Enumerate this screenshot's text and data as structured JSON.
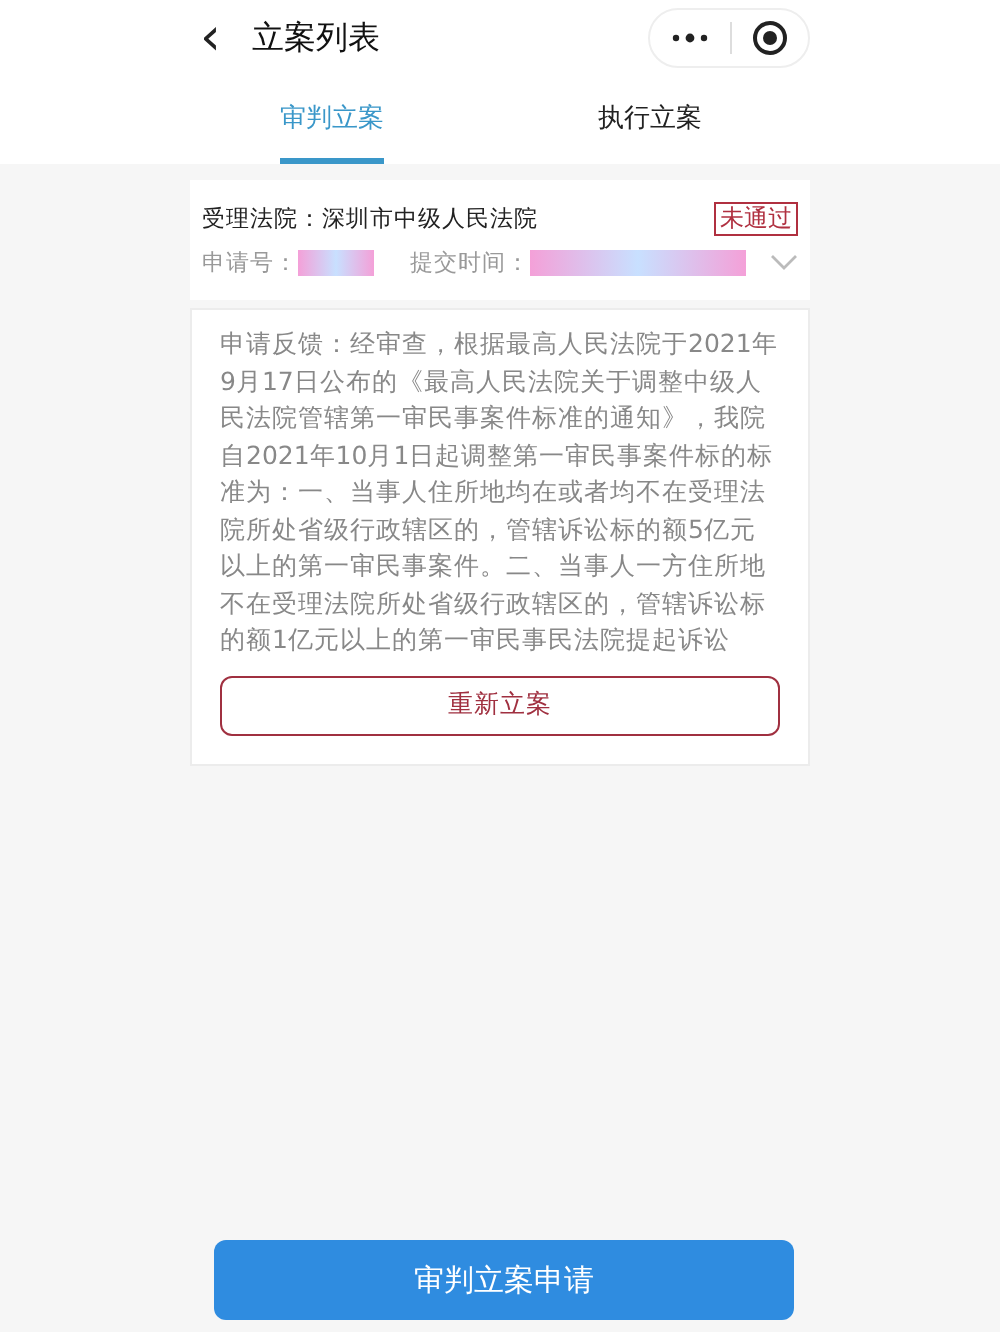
{
  "header": {
    "back": "‹",
    "title": "立案列表"
  },
  "tabs": [
    {
      "label": "审判立案",
      "selected": true
    },
    {
      "label": "执行立案",
      "selected": false
    }
  ],
  "case": {
    "court_label": "受理法院：",
    "court": "深圳市中级人民法院",
    "status": "未通过",
    "number_label": "申请号：",
    "time_label": "提交时间：",
    "expanded": false
  },
  "feedback": {
    "text": "申请反馈：经审查，根据最高人民法院于2021年9月17日公布的《最高人民法院关于调整中级人民法院管辖第一审民事案件标准的通知》，我院自2021年10月1日起调整第一审民事案件标的标准为：一、当事人住所地均在或者均不在受理法院所处省级行政辖区的，管辖诉讼标的额5亿元以上的第一审民事案件。二、当事人一方住所地不在受理法院所处省级行政辖区的，管辖诉讼标的额1亿元以上的第一审民事民法院提起诉讼",
    "button": "重新立案"
  },
  "submit": "审判立案申请"
}
